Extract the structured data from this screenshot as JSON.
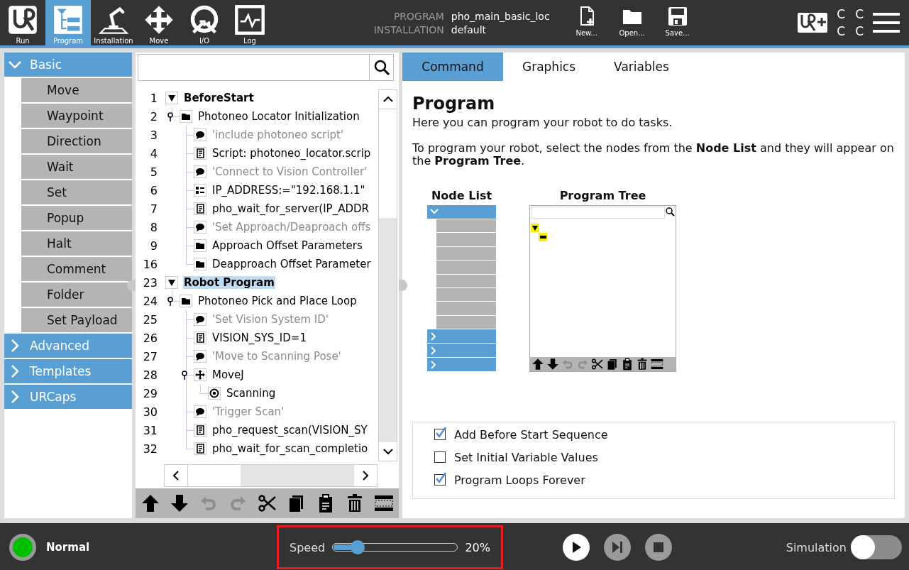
{
  "nav": [
    {
      "label": "Run",
      "selected": false
    },
    {
      "label": "Program",
      "selected": true
    },
    {
      "label": "Installation",
      "selected": false
    },
    {
      "label": "Move",
      "selected": false
    },
    {
      "label": "I/O",
      "selected": false
    },
    {
      "label": "Log",
      "selected": false
    }
  ],
  "file": {
    "program_label": "PROGRAM",
    "program_name": "pho_main_basic_loc",
    "installation_label": "INSTALLATION",
    "installation_name": "default"
  },
  "file_actions": [
    "New...",
    "Open...",
    "Save..."
  ],
  "indicator_letters": [
    "C",
    "C",
    "C",
    "C"
  ],
  "sidebar": {
    "categories": [
      {
        "label": "Basic",
        "expanded": true,
        "items": [
          "Move",
          "Waypoint",
          "Direction",
          "Wait",
          "Set",
          "Popup",
          "Halt",
          "Comment",
          "Folder",
          "Set Payload"
        ]
      },
      {
        "label": "Advanced",
        "expanded": false
      },
      {
        "label": "Templates",
        "expanded": false
      },
      {
        "label": "URCaps",
        "expanded": false
      }
    ]
  },
  "tree": {
    "rows": [
      {
        "number": "1",
        "label": "BeforeStart",
        "kind": "section",
        "expanded": true,
        "selected": false,
        "children": [
          {
            "number": "2",
            "label": "Photoneo Locator Initialization",
            "kind": "folder",
            "expanded": true,
            "selected": false,
            "children": [
              {
                "number": "3",
                "label": "'include photoneo script'",
                "kind": "comment",
                "selected": false
              },
              {
                "number": "4",
                "label": "Script: photoneo_locator.scrip",
                "kind": "script",
                "selected": false
              },
              {
                "number": "5",
                "label": "'Connect to Vision Controller'",
                "kind": "comment",
                "selected": false
              },
              {
                "number": "6",
                "label": "IP_ADDRESS:=\"192.168.1.1\"",
                "kind": "assignment",
                "selected": false
              },
              {
                "number": "7",
                "label": "pho_wait_for_server(IP_ADDR",
                "kind": "script",
                "selected": false
              },
              {
                "number": "8",
                "label": "'Set Approach/Deaproach offs",
                "kind": "comment",
                "selected": false
              },
              {
                "number": "9",
                "label": "Approach Offset Parameters",
                "kind": "folder",
                "expanded": false,
                "selected": false
              },
              {
                "number": "16",
                "label": "Deapproach Offset Parameter",
                "kind": "folder",
                "expanded": false,
                "selected": false
              }
            ]
          }
        ]
      },
      {
        "number": "23",
        "label": "Robot Program",
        "kind": "section",
        "expanded": true,
        "selected": true,
        "children": [
          {
            "number": "24",
            "label": "Photoneo Pick and Place Loop",
            "kind": "folder",
            "expanded": true,
            "selected": false,
            "children": [
              {
                "number": "25",
                "label": "'Set Vision System ID'",
                "kind": "comment",
                "selected": false
              },
              {
                "number": "26",
                "label": "VISION_SYS_ID=1",
                "kind": "script",
                "selected": false
              },
              {
                "number": "27",
                "label": "'Move to Scanning Pose'",
                "kind": "comment",
                "selected": false
              },
              {
                "number": "28",
                "label": "MoveJ",
                "kind": "move",
                "expanded": true,
                "selected": false,
                "children": [
                  {
                    "number": "29",
                    "label": "Scanning",
                    "kind": "waypoint",
                    "selected": false
                  }
                ]
              },
              {
                "number": "30",
                "label": "'Trigger Scan'",
                "kind": "comment",
                "selected": false
              },
              {
                "number": "31",
                "label": "pho_request_scan(VISION_SY",
                "kind": "script",
                "selected": false
              },
              {
                "number": "32",
                "label": "pho_wait_for_scan_completio",
                "kind": "script",
                "selected": false
              }
            ]
          }
        ]
      }
    ],
    "toolbar": [
      {
        "kind": "up",
        "disabled": false
      },
      {
        "kind": "down",
        "disabled": false
      },
      {
        "kind": "undo",
        "disabled": true
      },
      {
        "kind": "redo",
        "disabled": true
      },
      {
        "kind": "cut",
        "disabled": false
      },
      {
        "kind": "copy",
        "disabled": false
      },
      {
        "kind": "paste",
        "disabled": false
      },
      {
        "kind": "delete",
        "disabled": false
      },
      {
        "kind": "suppress",
        "disabled": false
      }
    ]
  },
  "tabs": [
    {
      "label": "Command",
      "selected": true
    },
    {
      "label": "Graphics",
      "selected": false
    },
    {
      "label": "Variables",
      "selected": false
    }
  ],
  "command": {
    "title": "Program",
    "intro": "Here you can program your robot to do tasks.",
    "instructions": "To program your robot, select the nodes from the **Node List** and they will appear on the **Program Tree**.",
    "node_list_label": "Node List",
    "program_tree_label": "Program Tree",
    "options": [
      {
        "label": "Add Before Start Sequence",
        "checked": true
      },
      {
        "label": "Set Initial Variable Values",
        "checked": false
      },
      {
        "label": "Program Loops Forever",
        "checked": true
      }
    ]
  },
  "status": {
    "label": "Normal",
    "kind": "normal"
  },
  "speed": {
    "label": "Speed",
    "level": 0.2,
    "reading": "20%",
    "highlighted": true
  },
  "playback": [
    {
      "kind": "play",
      "disabled": false
    },
    {
      "kind": "step",
      "disabled": true
    },
    {
      "kind": "stop",
      "disabled": true
    }
  ],
  "simulation": {
    "label": "Simulation",
    "on": false
  }
}
